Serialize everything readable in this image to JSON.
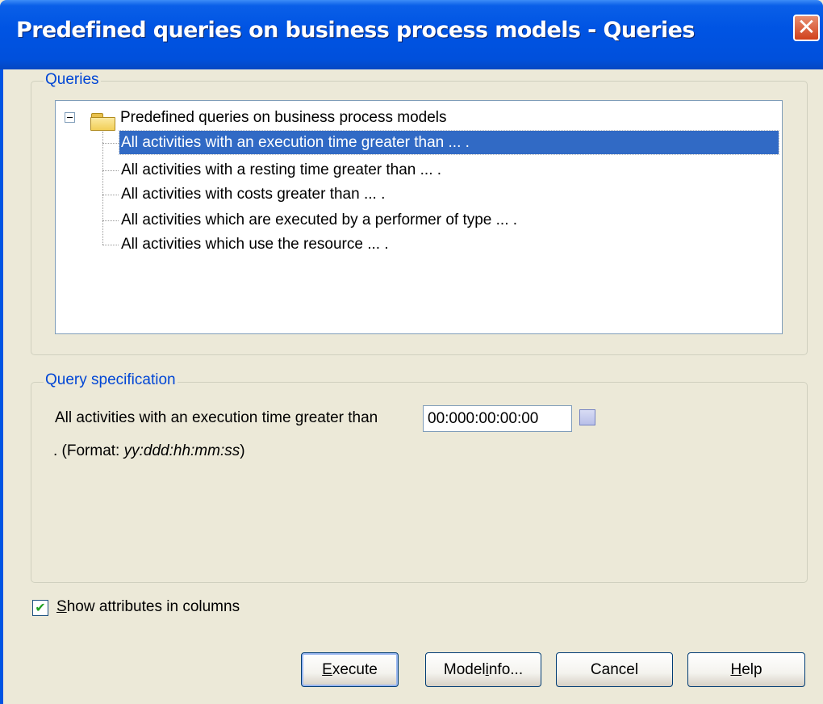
{
  "window": {
    "title": "Predefined queries on business process models - Queries",
    "close_symbol": "✕"
  },
  "queries_group": {
    "legend": "Queries",
    "tree": {
      "root_label": "Predefined queries on business process models",
      "items": [
        {
          "label": "All activities with an execution time greater than ... .",
          "selected": true
        },
        {
          "label": "All activities with a resting time greater than ... .",
          "selected": false
        },
        {
          "label": "All activities with costs greater than ... .",
          "selected": false
        },
        {
          "label": "All activities which are executed by a performer of type ... .",
          "selected": false
        },
        {
          "label": "All activities which use the resource ... .",
          "selected": false
        }
      ]
    }
  },
  "spec_group": {
    "legend": "Query specification",
    "prefix": "All activities with an execution time greater than",
    "time_value": "00:000:00:00:00",
    "format_prefix": ". (Format: ",
    "format_value": "yy:ddd:hh:mm:ss",
    "format_suffix": ")"
  },
  "show_attributes": {
    "checked": true,
    "checkmark": "✔",
    "label_first": "S",
    "label_rest": "how attributes in columns"
  },
  "buttons": {
    "execute_u": "E",
    "execute_rest": "xecute",
    "model_info_pre": "Model ",
    "model_info_u": "i",
    "model_info_post": "nfo...",
    "cancel": "Cancel",
    "help_u": "H",
    "help_rest": "elp"
  }
}
